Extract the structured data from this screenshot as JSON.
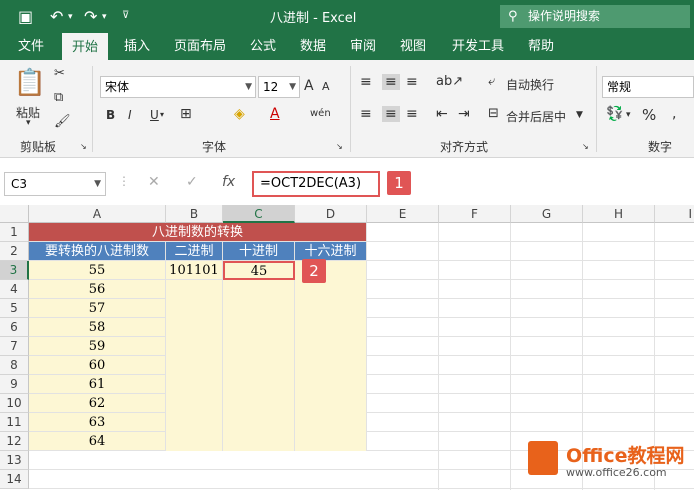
{
  "titlebar": {
    "title": "八进制 - Excel",
    "search_placeholder": "操作说明搜索",
    "accent_color": "#217346"
  },
  "tabs": [
    "文件",
    "开始",
    "插入",
    "页面布局",
    "公式",
    "数据",
    "审阅",
    "视图",
    "开发工具",
    "帮助"
  ],
  "active_tab": "开始",
  "ribbon": {
    "clipboard": {
      "paste_label": "粘贴",
      "group_label": "剪贴板"
    },
    "font": {
      "font_name": "宋体",
      "font_size": "12",
      "group_label": "字体",
      "bold": "B",
      "italic": "I",
      "underline": "U"
    },
    "alignment": {
      "wrap_label": "自动换行",
      "merge_label": "合并后居中",
      "group_label": "对齐方式"
    },
    "number": {
      "format_value": "常规",
      "group_label": "数字",
      "percent": "%"
    }
  },
  "formula_bar": {
    "name_box": "C3",
    "formula": "=OCT2DEC(A3)",
    "fx": "fx",
    "badge1": "1"
  },
  "sheet": {
    "columns": [
      "A",
      "B",
      "C",
      "D",
      "E",
      "F",
      "G",
      "H",
      "I"
    ],
    "rows": [
      "1",
      "2",
      "3",
      "4",
      "5",
      "6",
      "7",
      "8",
      "9",
      "10",
      "11",
      "12",
      "13",
      "14"
    ],
    "title": "八进制数的转换",
    "headers": [
      "要转换的八进制数",
      "二进制",
      "十进制",
      "十六进制"
    ],
    "col_a_values": [
      "55",
      "56",
      "57",
      "58",
      "59",
      "60",
      "61",
      "62",
      "63",
      "64"
    ],
    "b3": "101101",
    "c3": "45",
    "badge2": "2",
    "title_color": "#c0504d",
    "header_color": "#4f81bd",
    "data_fill_color": "#fdf7d4"
  },
  "watermark": {
    "brand": "Office教程网",
    "url": "www.office26.com"
  }
}
